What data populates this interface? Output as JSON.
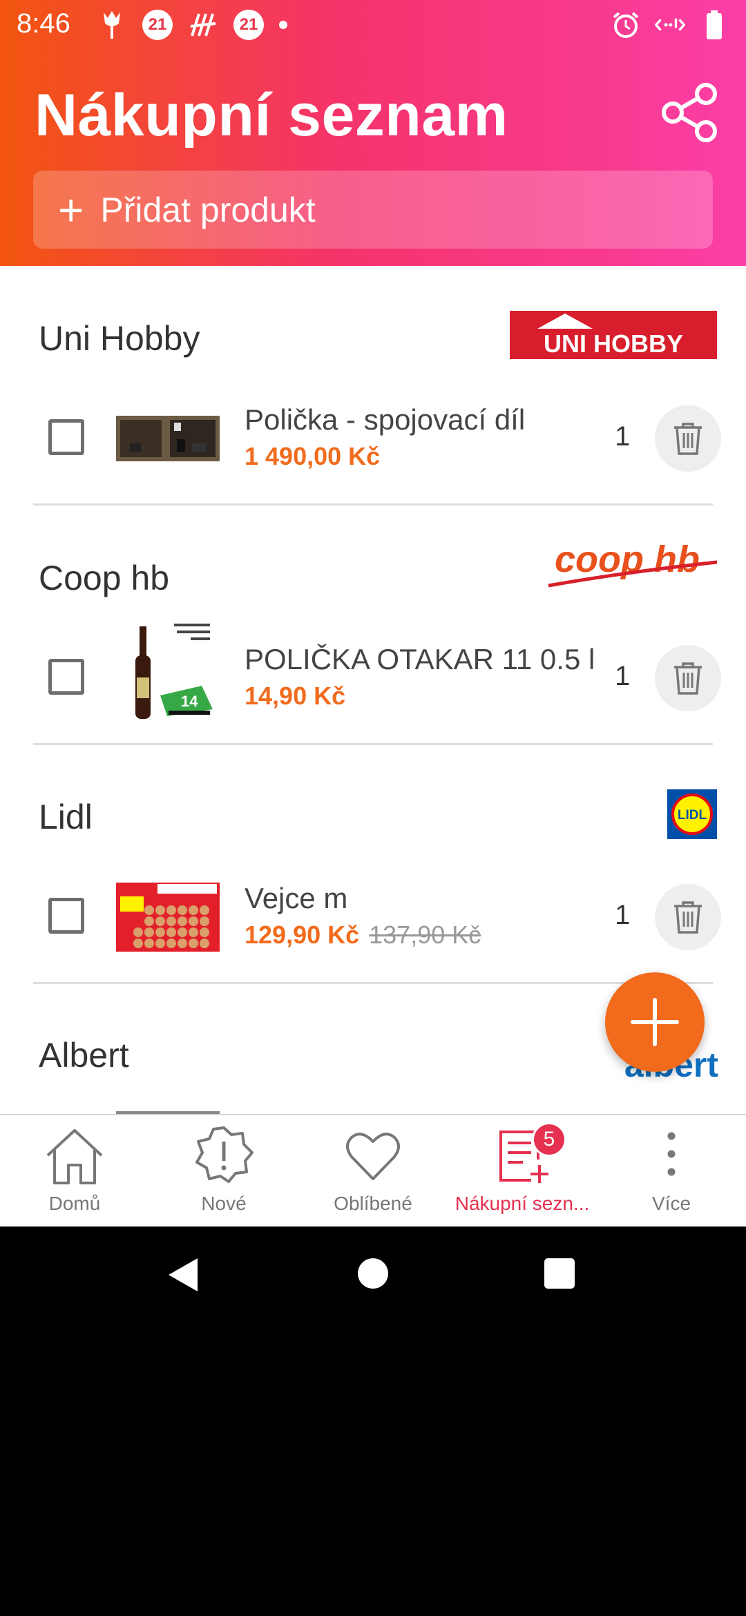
{
  "status_bar": {
    "time": "8:46",
    "badge_a": "21",
    "badge_b": "21"
  },
  "header": {
    "title": "Nákupní seznam",
    "add_product_label": "Přidat produkt"
  },
  "stores": [
    {
      "name": "Uni Hobby",
      "logo_text": "UNI HOBBY",
      "items": [
        {
          "name": "Polička - spojovací díl",
          "price": "1 490,00 Kč",
          "old_price": "",
          "qty": "1"
        }
      ]
    },
    {
      "name": "Coop hb",
      "logo_text": "coop hb",
      "items": [
        {
          "name": "POLIČKA OTAKAR 11 0.5 l",
          "price": "14,90 Kč",
          "old_price": "",
          "qty": "1"
        }
      ]
    },
    {
      "name": "Lidl",
      "logo_text": "LIDL",
      "items": [
        {
          "name": "Vejce m",
          "price": "129,90 Kč",
          "old_price": "137,90 Kč",
          "qty": "1"
        }
      ]
    },
    {
      "name": "Albert",
      "logo_text": "albert",
      "items": []
    }
  ],
  "bottom_nav": {
    "items": [
      {
        "label": "Domů"
      },
      {
        "label": "Nové"
      },
      {
        "label": "Oblíbené"
      },
      {
        "label": "Nákupní sezn...",
        "badge": "5"
      },
      {
        "label": "Více"
      }
    ]
  },
  "colors": {
    "accent": "#f26b1d",
    "active": "#e5304f",
    "header_start": "#f2550f",
    "header_end": "#fb3fa8"
  }
}
